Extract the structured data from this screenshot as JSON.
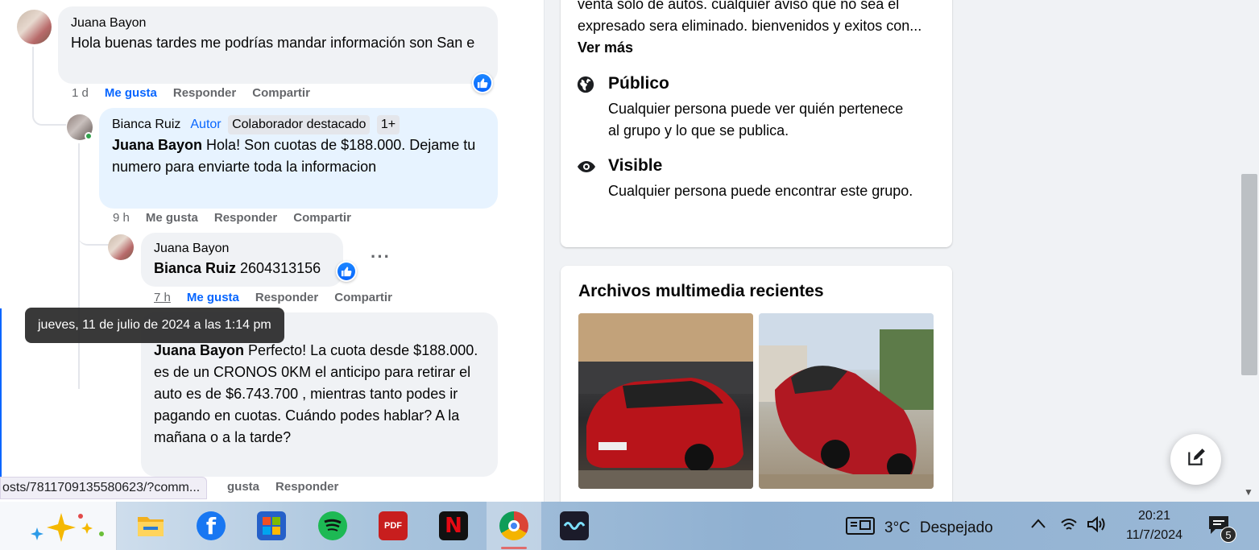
{
  "comments": [
    {
      "author": "Juana Bayon",
      "text": "Hola buenas tardes me podrías mandar información son San e",
      "time": "1 d",
      "like": "Me gusta",
      "reply": "Responder",
      "share": "Compartir"
    },
    {
      "author": "Bianca Ruiz",
      "badge_author": "Autor",
      "badge_top": "Colaborador destacado",
      "badge_more": "1+",
      "mention": "Juana Bayon",
      "text": " Hola! Son cuotas de $188.000. Dejame tu numero para enviarte toda la informacion",
      "time": "9 h",
      "like": "Me gusta",
      "reply": "Responder",
      "share": "Compartir"
    },
    {
      "author": "Juana Bayon",
      "mention": "Bianca Ruiz",
      "text": " 2604313156",
      "time": "7 h",
      "like": "Me gusta",
      "reply": "Responder",
      "share": "Compartir"
    },
    {
      "mention": "Juana Bayon",
      "text": " Perfecto! La cuota desde $188.000. es de un CRONOS 0KM el anticipo para retirar el auto es de $6.743.700 , mientras tanto podes ir pagando en cuotas. Cuándo podes hablar? A la mañana o a la tarde?",
      "like": "gusta",
      "reply": "Responder"
    }
  ],
  "tooltip": "jueves, 11 de julio de 2024 a las 1:14 pm",
  "status_url": "osts/7811709135580623/?comm...",
  "about": {
    "description": "venta solo de autos. cualquier aviso que no sea el expresado sera eliminado. bienvenidos y exitos con...",
    "see_more": "Ver más",
    "public_title": "Público",
    "public_desc": "Cualquier persona puede ver quién pertenece al grupo y lo que se publica.",
    "visible_title": "Visible",
    "visible_desc": "Cualquier persona puede encontrar este grupo."
  },
  "media": {
    "title": "Archivos multimedia recientes"
  },
  "taskbar": {
    "weather_temp": "3°C",
    "weather_desc": "Despejado",
    "time": "20:21",
    "date": "11/7/2024",
    "notifications": "5",
    "pdf_label": "PDF"
  },
  "colors": {
    "accent": "#0866ff",
    "secondary_text": "#65676b",
    "bubble": "#f0f2f5",
    "author_bubble": "#e7f3ff"
  }
}
